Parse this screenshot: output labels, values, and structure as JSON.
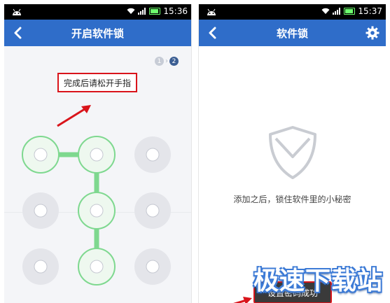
{
  "left_screen": {
    "status": {
      "time": "15:36"
    },
    "title": "开启软件锁",
    "steps": [
      "1",
      "2"
    ],
    "hint": "完成后请松开手指"
  },
  "right_screen": {
    "status": {
      "time": "15:37"
    },
    "title": "软件锁",
    "description": "添加之后，锁住软件里的小秘密",
    "toast": "设置密码成功"
  },
  "watermark": "极速下载站",
  "colors": {
    "title_bar": "#2f6dc9",
    "pattern_active": "#7ed88f",
    "highlight_red": "#d9141b",
    "step_active": "#3b5e93"
  },
  "icons": {
    "back": "chevron-left-icon",
    "settings": "gear-icon",
    "logo": "shield-icon"
  }
}
